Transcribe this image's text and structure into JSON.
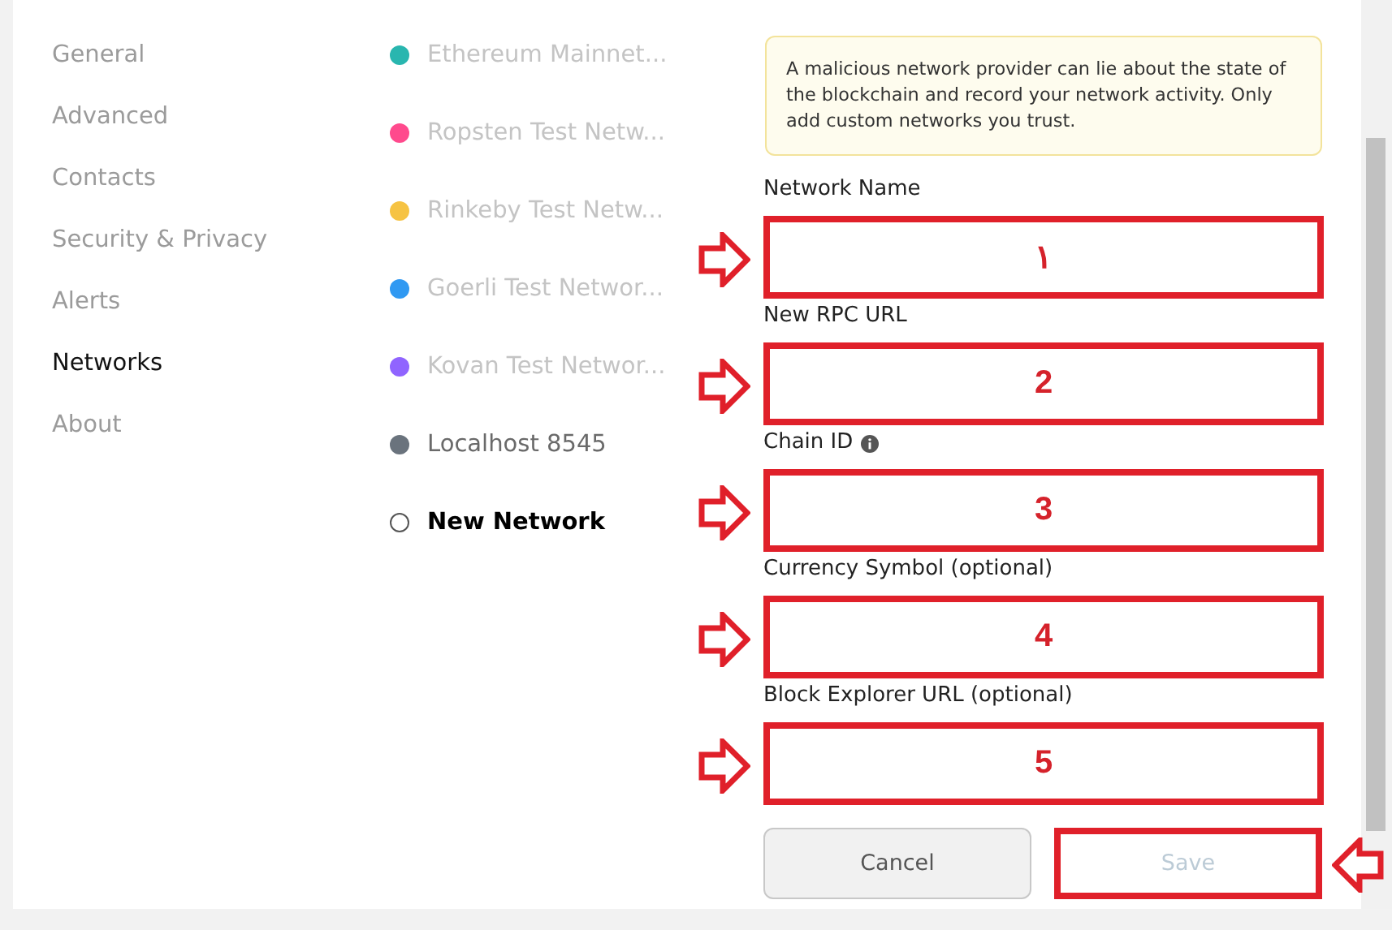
{
  "sidebar": {
    "items": [
      {
        "label": "General",
        "selected": false
      },
      {
        "label": "Advanced",
        "selected": false
      },
      {
        "label": "Contacts",
        "selected": false
      },
      {
        "label": "Security & Privacy",
        "selected": false
      },
      {
        "label": "Alerts",
        "selected": false
      },
      {
        "label": "Networks",
        "selected": true
      },
      {
        "label": "About",
        "selected": false
      }
    ]
  },
  "networks": [
    {
      "label": "Ethereum Mainnet...",
      "color": "#29b6af",
      "dimmed": true,
      "selected": false
    },
    {
      "label": "Ropsten Test Netw...",
      "color": "#ff4a8d",
      "dimmed": true,
      "selected": false
    },
    {
      "label": "Rinkeby Test Netw...",
      "color": "#f6c343",
      "dimmed": true,
      "selected": false
    },
    {
      "label": "Goerli Test Networ...",
      "color": "#3099f2",
      "dimmed": true,
      "selected": false
    },
    {
      "label": "Kovan Test Networ...",
      "color": "#9064ff",
      "dimmed": true,
      "selected": false
    },
    {
      "label": "Localhost 8545",
      "color": "#6a737d",
      "dimmed": false,
      "selected": false
    },
    {
      "label": "New Network",
      "dimmed": false,
      "selected": true
    }
  ],
  "form": {
    "warning": "A malicious network provider can lie about the state of the blockchain and record your network activity. Only add custom networks you trust.",
    "fields": [
      {
        "label": "Network Name",
        "marker": "١",
        "info": false
      },
      {
        "label": "New RPC URL",
        "marker": "2",
        "info": false
      },
      {
        "label": "Chain ID",
        "marker": "3",
        "info": true
      },
      {
        "label": "Currency Symbol (optional)",
        "marker": "4",
        "info": false
      },
      {
        "label": "Block Explorer URL (optional)",
        "marker": "5",
        "info": false
      }
    ],
    "buttons": [
      {
        "label": "Cancel",
        "kind": "cancel",
        "disabled": false
      },
      {
        "label": "Save",
        "kind": "save",
        "disabled": true
      }
    ]
  }
}
